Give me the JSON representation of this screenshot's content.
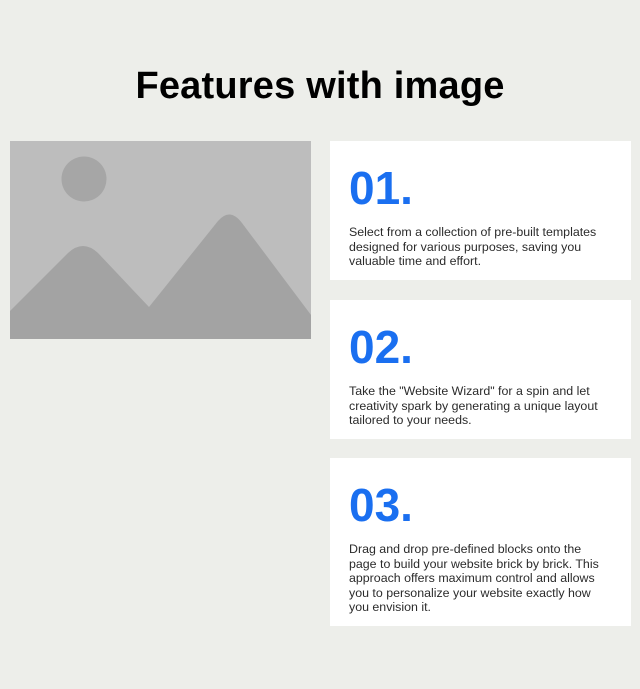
{
  "section": {
    "title": "Features with image"
  },
  "image": {
    "icon": "image-placeholder-icon",
    "colors": {
      "background": "#bdbdbd",
      "sun": "#a6a6a6",
      "mountains": "#a3a3a3"
    }
  },
  "features": [
    {
      "number": "01.",
      "text": "Select from a collection of pre-built templates designed for various purposes, saving you valuable time and effort."
    },
    {
      "number": "02.",
      "text": "Take the \"Website Wizard\" for a spin and let creativity spark by generating a unique layout tailored to your needs."
    },
    {
      "number": "03.",
      "text": "Drag and drop pre-defined blocks onto the page to build your website brick by brick. This approach offers maximum control and allows you to personalize your website exactly how you envision it."
    }
  ],
  "colors": {
    "page_background": "#edeeea",
    "card_background": "#ffffff",
    "accent": "#1a6ff0",
    "title": "#000000",
    "body_text": "#2b2b2b"
  }
}
